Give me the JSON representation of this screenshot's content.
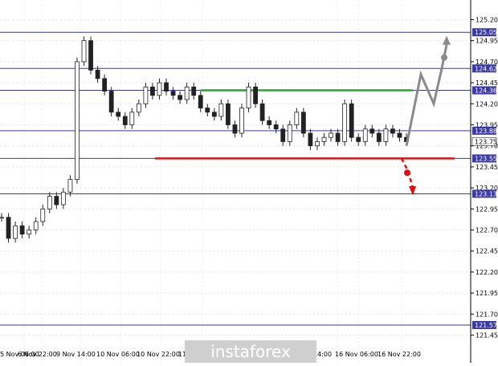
{
  "chart_data": {
    "type": "candlestick",
    "ylim": [
      121.35,
      125.3
    ],
    "y_ticks": [
      "125.20",
      "124.95",
      "124.70",
      "124.45",
      "124.20",
      "123.95",
      "123.70",
      "123.45",
      "123.20",
      "122.95",
      "122.70",
      "122.45",
      "122.20",
      "121.95",
      "121.70",
      "121.45"
    ],
    "x_ticks": [
      "5 Nov 06:00",
      "6 Nov 22:00",
      "9 Nov 14:00",
      "10 Nov 06:00",
      "10 Nov 22:00",
      "11",
      "14:00",
      "16 Nov 06:00",
      "16 Nov 22:00"
    ],
    "levels": [
      {
        "value": "125.05"
      },
      {
        "value": "124.62"
      },
      {
        "value": "124.36"
      },
      {
        "value": "123.88"
      },
      {
        "value": "123.55"
      },
      {
        "value": "123.13"
      },
      {
        "value": "121.57"
      }
    ],
    "current_price": "123.75",
    "support_resistance": [
      {
        "kind": "resistance",
        "value": 124.36,
        "color": "#22aa22"
      },
      {
        "kind": "support",
        "value": 123.55,
        "color": "#dd1111"
      }
    ],
    "candles_path": [
      122.85,
      122.6,
      122.75,
      122.65,
      122.7,
      122.8,
      122.95,
      123.1,
      123.0,
      123.15,
      123.3,
      124.7,
      124.95,
      124.6,
      124.5,
      124.35,
      124.1,
      124.05,
      123.95,
      124.1,
      124.2,
      124.4,
      124.3,
      124.45,
      124.35,
      124.3,
      124.25,
      124.4,
      124.3,
      124.15,
      124.1,
      124.05,
      124.2,
      123.95,
      123.85,
      124.15,
      124.4,
      124.2,
      124.0,
      123.95,
      123.9,
      123.75,
      123.95,
      124.1,
      123.85,
      123.7,
      123.75,
      123.8,
      123.85,
      123.75,
      124.2,
      123.8,
      123.75,
      123.9,
      123.85,
      123.75,
      123.9,
      123.85,
      123.8,
      123.75
    ],
    "forecast_up": [
      123.7,
      124.55,
      124.2,
      124.62,
      124.9
    ],
    "forecast_down": [
      123.55,
      123.4,
      123.2
    ],
    "watermark": "instaforex",
    "colors": {
      "level_line": "#3a3aa6",
      "candle": "#222222",
      "forecast_up": "#8a8a8a",
      "forecast_down": "#e01010",
      "watermark_bg": "#cfcfcf"
    }
  }
}
